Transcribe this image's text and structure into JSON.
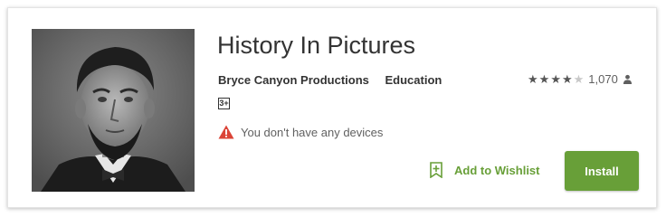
{
  "app": {
    "title": "History In Pictures",
    "developer": "Bryce Canyon Productions",
    "category": "Education",
    "content_rating_badge": "3+",
    "rating_value": 4,
    "rating_max": 5,
    "rating_count": "1,070",
    "cover_icon": "portrait-photo"
  },
  "notice": {
    "text": "You don't have any devices",
    "icon": "warning-icon"
  },
  "actions": {
    "wishlist_label": "Add to Wishlist",
    "install_label": "Install"
  },
  "colors": {
    "accent_green": "#689f38",
    "warning_red": "#db4437"
  }
}
